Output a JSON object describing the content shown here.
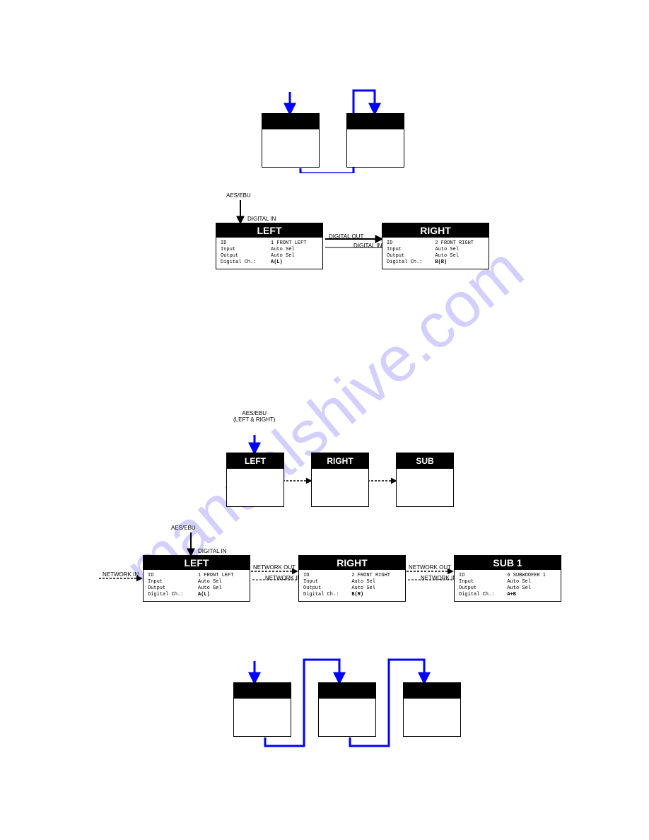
{
  "labels": {
    "aesebu": "AES/EBU",
    "aesebu_lr": "AES/EBU\n(LEFT & RIGHT)",
    "digital_in": "DIGITAL IN",
    "digital_out": "DIGITAL OUT",
    "network_in": "NETWORK IN",
    "network_out": "NETWORK OUT"
  },
  "speakers": {
    "left": "LEFT",
    "right": "RIGHT",
    "sub": "SUB",
    "sub1": "SUB 1"
  },
  "details": {
    "left": [
      [
        "ID",
        "1  FRONT LEFT"
      ],
      [
        "Input",
        "Auto Sel"
      ],
      [
        "Output",
        "Auto Sel"
      ],
      [
        "Digital Ch.:",
        "A(L)"
      ]
    ],
    "right": [
      [
        "ID",
        "2  FRONT RIGHT"
      ],
      [
        "Input",
        "Auto Sel"
      ],
      [
        "Output",
        "Auto Sel"
      ],
      [
        "Digital Ch.:",
        "B(R)"
      ]
    ],
    "sub1": [
      [
        "ID",
        "6  SUBWOOFER 1"
      ],
      [
        "Input",
        "Auto Sel"
      ],
      [
        "Output",
        "Auto Sel"
      ],
      [
        "Digital Ch.:",
        "A+B"
      ]
    ]
  },
  "watermark": "manualshive.com"
}
